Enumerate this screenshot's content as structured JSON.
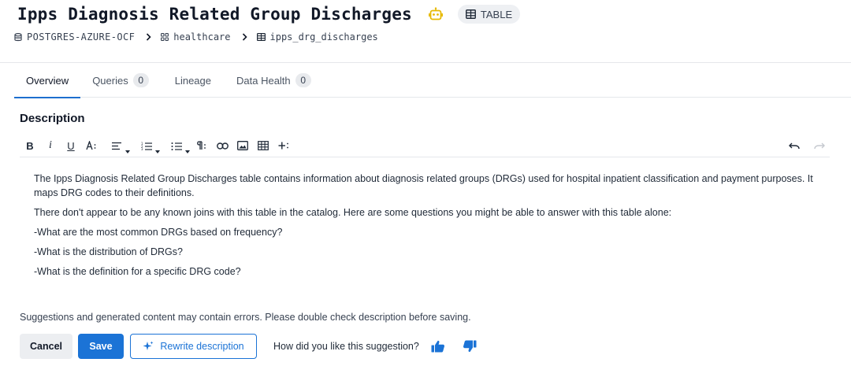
{
  "header": {
    "title": "Ipps Diagnosis Related Group Discharges",
    "bot_icon": "robot-icon",
    "type_badge": "TABLE",
    "colors": {
      "accent": "#1b73d6",
      "bot": "#e6b800"
    }
  },
  "breadcrumb": {
    "database": "POSTGRES-AZURE-OCF",
    "schema": "healthcare",
    "table": "ipps_drg_discharges"
  },
  "tabs": [
    {
      "label": "Overview",
      "count": null,
      "active": true
    },
    {
      "label": "Queries",
      "count": "0",
      "active": false
    },
    {
      "label": "Lineage",
      "count": null,
      "active": false
    },
    {
      "label": "Data Health",
      "count": "0",
      "active": false
    }
  ],
  "description": {
    "heading": "Description",
    "toolbar": [
      "bold-icon",
      "italic-icon",
      "underline-icon",
      "font-size-icon",
      "align-icon",
      "ordered-list-icon",
      "bullet-list-icon",
      "paragraph-icon",
      "link-icon",
      "image-icon",
      "table-icon",
      "insert-more-icon",
      "undo-icon",
      "redo-icon"
    ],
    "paragraphs": [
      "The Ipps Diagnosis Related Group Discharges table contains information about diagnosis related groups (DRGs) used for hospital inpatient classification and payment purposes. It maps DRG codes to their definitions.",
      "There don't appear to be any known joins with this table in the catalog. Here are some questions you might be able to answer with this table alone:",
      "-What are the most common DRGs based on frequency?",
      "-What is the distribution of DRGs?",
      "-What is the definition for a specific DRG code?"
    ]
  },
  "disclaimer": "Suggestions and generated content may contain errors. Please double check description before saving.",
  "actions": {
    "cancel": "Cancel",
    "save": "Save",
    "rewrite": "Rewrite description",
    "feedback_question": "How did you like this suggestion?"
  }
}
